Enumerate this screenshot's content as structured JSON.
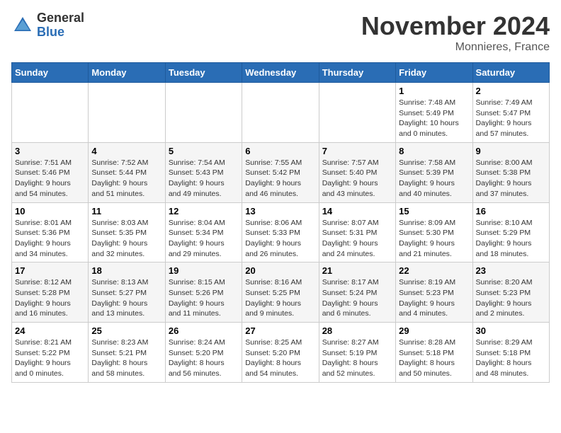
{
  "header": {
    "logo_line1": "General",
    "logo_line2": "Blue",
    "month": "November 2024",
    "location": "Monnieres, France"
  },
  "weekdays": [
    "Sunday",
    "Monday",
    "Tuesday",
    "Wednesday",
    "Thursday",
    "Friday",
    "Saturday"
  ],
  "weeks": [
    [
      {
        "day": "",
        "info": ""
      },
      {
        "day": "",
        "info": ""
      },
      {
        "day": "",
        "info": ""
      },
      {
        "day": "",
        "info": ""
      },
      {
        "day": "",
        "info": ""
      },
      {
        "day": "1",
        "info": "Sunrise: 7:48 AM\nSunset: 5:49 PM\nDaylight: 10 hours\nand 0 minutes."
      },
      {
        "day": "2",
        "info": "Sunrise: 7:49 AM\nSunset: 5:47 PM\nDaylight: 9 hours\nand 57 minutes."
      }
    ],
    [
      {
        "day": "3",
        "info": "Sunrise: 7:51 AM\nSunset: 5:46 PM\nDaylight: 9 hours\nand 54 minutes."
      },
      {
        "day": "4",
        "info": "Sunrise: 7:52 AM\nSunset: 5:44 PM\nDaylight: 9 hours\nand 51 minutes."
      },
      {
        "day": "5",
        "info": "Sunrise: 7:54 AM\nSunset: 5:43 PM\nDaylight: 9 hours\nand 49 minutes."
      },
      {
        "day": "6",
        "info": "Sunrise: 7:55 AM\nSunset: 5:42 PM\nDaylight: 9 hours\nand 46 minutes."
      },
      {
        "day": "7",
        "info": "Sunrise: 7:57 AM\nSunset: 5:40 PM\nDaylight: 9 hours\nand 43 minutes."
      },
      {
        "day": "8",
        "info": "Sunrise: 7:58 AM\nSunset: 5:39 PM\nDaylight: 9 hours\nand 40 minutes."
      },
      {
        "day": "9",
        "info": "Sunrise: 8:00 AM\nSunset: 5:38 PM\nDaylight: 9 hours\nand 37 minutes."
      }
    ],
    [
      {
        "day": "10",
        "info": "Sunrise: 8:01 AM\nSunset: 5:36 PM\nDaylight: 9 hours\nand 34 minutes."
      },
      {
        "day": "11",
        "info": "Sunrise: 8:03 AM\nSunset: 5:35 PM\nDaylight: 9 hours\nand 32 minutes."
      },
      {
        "day": "12",
        "info": "Sunrise: 8:04 AM\nSunset: 5:34 PM\nDaylight: 9 hours\nand 29 minutes."
      },
      {
        "day": "13",
        "info": "Sunrise: 8:06 AM\nSunset: 5:33 PM\nDaylight: 9 hours\nand 26 minutes."
      },
      {
        "day": "14",
        "info": "Sunrise: 8:07 AM\nSunset: 5:31 PM\nDaylight: 9 hours\nand 24 minutes."
      },
      {
        "day": "15",
        "info": "Sunrise: 8:09 AM\nSunset: 5:30 PM\nDaylight: 9 hours\nand 21 minutes."
      },
      {
        "day": "16",
        "info": "Sunrise: 8:10 AM\nSunset: 5:29 PM\nDaylight: 9 hours\nand 18 minutes."
      }
    ],
    [
      {
        "day": "17",
        "info": "Sunrise: 8:12 AM\nSunset: 5:28 PM\nDaylight: 9 hours\nand 16 minutes."
      },
      {
        "day": "18",
        "info": "Sunrise: 8:13 AM\nSunset: 5:27 PM\nDaylight: 9 hours\nand 13 minutes."
      },
      {
        "day": "19",
        "info": "Sunrise: 8:15 AM\nSunset: 5:26 PM\nDaylight: 9 hours\nand 11 minutes."
      },
      {
        "day": "20",
        "info": "Sunrise: 8:16 AM\nSunset: 5:25 PM\nDaylight: 9 hours\nand 9 minutes."
      },
      {
        "day": "21",
        "info": "Sunrise: 8:17 AM\nSunset: 5:24 PM\nDaylight: 9 hours\nand 6 minutes."
      },
      {
        "day": "22",
        "info": "Sunrise: 8:19 AM\nSunset: 5:23 PM\nDaylight: 9 hours\nand 4 minutes."
      },
      {
        "day": "23",
        "info": "Sunrise: 8:20 AM\nSunset: 5:23 PM\nDaylight: 9 hours\nand 2 minutes."
      }
    ],
    [
      {
        "day": "24",
        "info": "Sunrise: 8:21 AM\nSunset: 5:22 PM\nDaylight: 9 hours\nand 0 minutes."
      },
      {
        "day": "25",
        "info": "Sunrise: 8:23 AM\nSunset: 5:21 PM\nDaylight: 8 hours\nand 58 minutes."
      },
      {
        "day": "26",
        "info": "Sunrise: 8:24 AM\nSunset: 5:20 PM\nDaylight: 8 hours\nand 56 minutes."
      },
      {
        "day": "27",
        "info": "Sunrise: 8:25 AM\nSunset: 5:20 PM\nDaylight: 8 hours\nand 54 minutes."
      },
      {
        "day": "28",
        "info": "Sunrise: 8:27 AM\nSunset: 5:19 PM\nDaylight: 8 hours\nand 52 minutes."
      },
      {
        "day": "29",
        "info": "Sunrise: 8:28 AM\nSunset: 5:18 PM\nDaylight: 8 hours\nand 50 minutes."
      },
      {
        "day": "30",
        "info": "Sunrise: 8:29 AM\nSunset: 5:18 PM\nDaylight: 8 hours\nand 48 minutes."
      }
    ]
  ]
}
